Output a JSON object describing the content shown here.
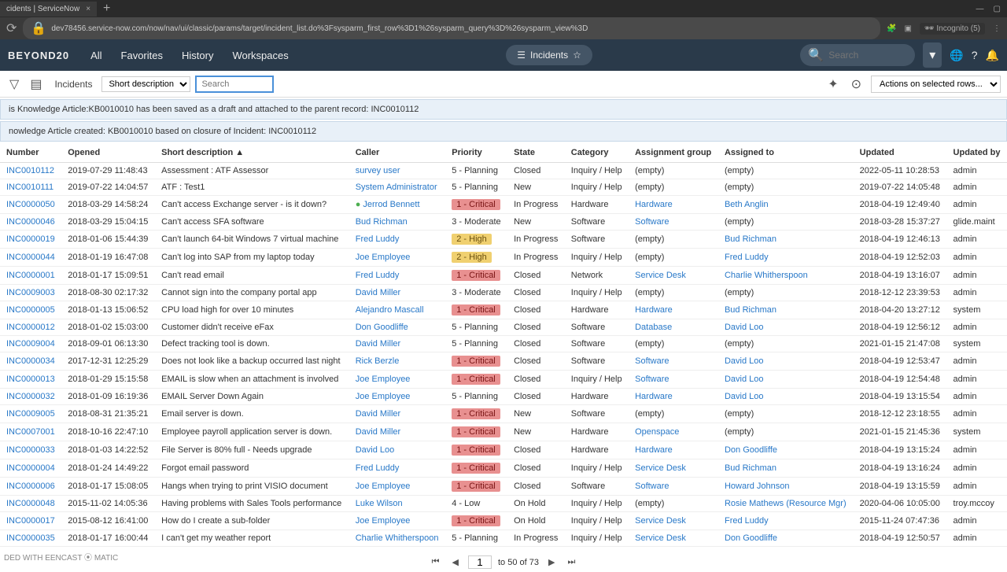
{
  "browser": {
    "tab_title": "cidents | ServiceNow",
    "url": "dev78456.service-now.com/now/nav/ui/classic/params/target/incident_list.do%3Fsysparm_first_row%3D1%26sysparm_query%3D%26sysparm_view%3D",
    "incognito": "Incognito (5)"
  },
  "nav": {
    "logo": "BEYOND20",
    "items": [
      "All",
      "Favorites",
      "History",
      "Workspaces"
    ],
    "center_label": "Incidents",
    "search_placeholder": "Search"
  },
  "toolbar": {
    "title": "Incidents",
    "filter_field": "Short description",
    "search_placeholder": "Search",
    "actions_label": "Actions on selected rows..."
  },
  "info1": "is Knowledge Article:KB0010010 has been saved as a draft and attached to the parent record: INC0010112",
  "info2": "nowledge Article created: KB0010010 based on closure of Incident: INC0010112",
  "columns": [
    "Number",
    "Opened",
    "Short description ▲",
    "Caller",
    "Priority",
    "State",
    "Category",
    "Assignment group",
    "Assigned to",
    "Updated",
    "Updated by"
  ],
  "rows": [
    {
      "n": "INC0010112",
      "o": "2019-07-29 11:48:43",
      "d": "Assessment : ATF Assessor",
      "c": "survey user",
      "p": "5 - Planning",
      "s": "Closed",
      "cat": "Inquiry / Help",
      "g": "(empty)",
      "a": "(empty)",
      "u": "2022-05-11 10:28:53",
      "ub": "admin"
    },
    {
      "n": "INC0010111",
      "o": "2019-07-22 14:04:57",
      "d": "ATF : Test1",
      "c": "System Administrator",
      "p": "5 - Planning",
      "s": "New",
      "cat": "Inquiry / Help",
      "g": "(empty)",
      "a": "(empty)",
      "u": "2019-07-22 14:05:48",
      "ub": "admin"
    },
    {
      "n": "INC0000050",
      "o": "2018-03-29 14:58:24",
      "d": "Can't access Exchange server - is it down?",
      "c": "Jerrod Bennett",
      "ol": true,
      "p": "1 - Critical",
      "pb": "critical",
      "s": "In Progress",
      "cat": "Hardware",
      "g": "Hardware",
      "a": "Beth Anglin",
      "u": "2018-04-19 12:49:40",
      "ub": "admin"
    },
    {
      "n": "INC0000046",
      "o": "2018-03-29 15:04:15",
      "d": "Can't access SFA software",
      "c": "Bud Richman",
      "p": "3 - Moderate",
      "s": "New",
      "cat": "Software",
      "g": "Software",
      "a": "(empty)",
      "u": "2018-03-28 15:37:27",
      "ub": "glide.maint"
    },
    {
      "n": "INC0000019",
      "o": "2018-01-06 15:44:39",
      "d": "Can't launch 64-bit Windows 7 virtual machine",
      "c": "Fred Luddy",
      "p": "2 - High",
      "pb": "high",
      "s": "In Progress",
      "cat": "Software",
      "g": "(empty)",
      "a": "Bud Richman",
      "u": "2018-04-19 12:46:13",
      "ub": "admin"
    },
    {
      "n": "INC0000044",
      "o": "2018-01-19 16:47:08",
      "d": "Can't log into SAP from my laptop today",
      "c": "Joe Employee",
      "p": "2 - High",
      "pb": "high",
      "s": "In Progress",
      "cat": "Inquiry / Help",
      "g": "(empty)",
      "a": "Fred Luddy",
      "u": "2018-04-19 12:52:03",
      "ub": "admin"
    },
    {
      "n": "INC0000001",
      "o": "2018-01-17 15:09:51",
      "d": "Can't read email",
      "c": "Fred Luddy",
      "p": "1 - Critical",
      "pb": "critical",
      "s": "Closed",
      "cat": "Network",
      "g": "Service Desk",
      "a": "Charlie Whitherspoon",
      "u": "2018-04-19 13:16:07",
      "ub": "admin"
    },
    {
      "n": "INC0009003",
      "o": "2018-08-30 02:17:32",
      "d": "Cannot sign into the company portal app",
      "c": "David Miller",
      "p": "3 - Moderate",
      "s": "Closed",
      "cat": "Inquiry / Help",
      "g": "(empty)",
      "a": "(empty)",
      "u": "2018-12-12 23:39:53",
      "ub": "admin"
    },
    {
      "n": "INC0000005",
      "o": "2018-01-13 15:06:52",
      "d": "CPU load high for over 10 minutes",
      "c": "Alejandro Mascall",
      "p": "1 - Critical",
      "pb": "critical",
      "s": "Closed",
      "cat": "Hardware",
      "g": "Hardware",
      "a": "Bud Richman",
      "u": "2018-04-20 13:27:12",
      "ub": "system"
    },
    {
      "n": "INC0000012",
      "o": "2018-01-02 15:03:00",
      "d": "Customer didn't receive eFax",
      "c": "Don Goodliffe",
      "p": "5 - Planning",
      "s": "Closed",
      "cat": "Software",
      "g": "Database",
      "a": "David Loo",
      "u": "2018-04-19 12:56:12",
      "ub": "admin"
    },
    {
      "n": "INC0009004",
      "o": "2018-09-01 06:13:30",
      "d": "Defect tracking tool is down.",
      "c": "David Miller",
      "p": "5 - Planning",
      "s": "Closed",
      "cat": "Software",
      "g": "(empty)",
      "a": "(empty)",
      "u": "2021-01-15 21:47:08",
      "ub": "system"
    },
    {
      "n": "INC0000034",
      "o": "2017-12-31 12:25:29",
      "d": "Does not look like a backup occurred last night",
      "c": "Rick Berzle",
      "p": "1 - Critical",
      "pb": "critical",
      "s": "Closed",
      "cat": "Software",
      "g": "Software",
      "a": "David Loo",
      "u": "2018-04-19 12:53:47",
      "ub": "admin"
    },
    {
      "n": "INC0000013",
      "o": "2018-01-29 15:15:58",
      "d": "EMAIL is slow when an attachment is involved",
      "c": "Joe Employee",
      "p": "1 - Critical",
      "pb": "critical",
      "s": "Closed",
      "cat": "Inquiry / Help",
      "g": "Software",
      "a": "David Loo",
      "u": "2018-04-19 12:54:48",
      "ub": "admin"
    },
    {
      "n": "INC0000032",
      "o": "2018-01-09 16:19:36",
      "d": "EMAIL Server Down Again",
      "c": "Joe Employee",
      "p": "5 - Planning",
      "s": "Closed",
      "cat": "Hardware",
      "g": "Hardware",
      "a": "David Loo",
      "u": "2018-04-19 13:15:54",
      "ub": "admin"
    },
    {
      "n": "INC0009005",
      "o": "2018-08-31 21:35:21",
      "d": "Email server is down.",
      "c": "David Miller",
      "p": "1 - Critical",
      "pb": "critical",
      "s": "New",
      "cat": "Software",
      "g": "(empty)",
      "a": "(empty)",
      "u": "2018-12-12 23:18:55",
      "ub": "admin"
    },
    {
      "n": "INC0007001",
      "o": "2018-10-16 22:47:10",
      "d": "Employee payroll application server is down.",
      "c": "David Miller",
      "p": "1 - Critical",
      "pb": "critical",
      "s": "New",
      "cat": "Hardware",
      "g": "Openspace",
      "a": "(empty)",
      "u": "2021-01-15 21:45:36",
      "ub": "system"
    },
    {
      "n": "INC0000033",
      "o": "2018-01-03 14:22:52",
      "d": "File Server is 80% full - Needs upgrade",
      "c": "David Loo",
      "p": "1 - Critical",
      "pb": "critical",
      "s": "Closed",
      "cat": "Hardware",
      "g": "Hardware",
      "a": "Don Goodliffe",
      "u": "2018-04-19 13:15:24",
      "ub": "admin"
    },
    {
      "n": "INC0000004",
      "o": "2018-01-24 14:49:22",
      "d": "Forgot email password",
      "c": "Fred Luddy",
      "p": "1 - Critical",
      "pb": "critical",
      "s": "Closed",
      "cat": "Inquiry / Help",
      "g": "Service Desk",
      "a": "Bud Richman",
      "u": "2018-04-19 13:16:24",
      "ub": "admin"
    },
    {
      "n": "INC0000006",
      "o": "2018-01-17 15:08:05",
      "d": "Hangs when trying to print VISIO document",
      "c": "Joe Employee",
      "p": "1 - Critical",
      "pb": "critical",
      "s": "Closed",
      "cat": "Software",
      "g": "Software",
      "a": "Howard Johnson",
      "u": "2018-04-19 13:15:59",
      "ub": "admin"
    },
    {
      "n": "INC0000048",
      "o": "2015-11-02 14:05:36",
      "d": "Having problems with Sales Tools performance",
      "c": "Luke Wilson",
      "p": "4 - Low",
      "s": "On Hold",
      "cat": "Inquiry / Help",
      "g": "(empty)",
      "a": "Rosie Mathews (Resource Mgr)",
      "u": "2020-04-06 10:05:00",
      "ub": "troy.mccoy"
    },
    {
      "n": "INC0000017",
      "o": "2015-08-12 16:41:00",
      "d": "How do I create a sub-folder",
      "c": "Joe Employee",
      "p": "1 - Critical",
      "pb": "critical",
      "s": "On Hold",
      "cat": "Inquiry / Help",
      "g": "Service Desk",
      "a": "Fred Luddy",
      "u": "2015-11-24 07:47:36",
      "ub": "admin"
    },
    {
      "n": "INC0000035",
      "o": "2018-01-17 16:00:44",
      "d": "I can't get my weather report",
      "c": "Charlie Whitherspoon",
      "p": "5 - Planning",
      "s": "In Progress",
      "cat": "Inquiry / Help",
      "g": "Service Desk",
      "a": "Don Goodliffe",
      "u": "2018-04-19 12:50:57",
      "ub": "admin"
    }
  ],
  "pager": {
    "page": "1",
    "range": "to 50 of 73"
  },
  "watermark": "DED WITH\nEENCAST ⦿ MATIC"
}
